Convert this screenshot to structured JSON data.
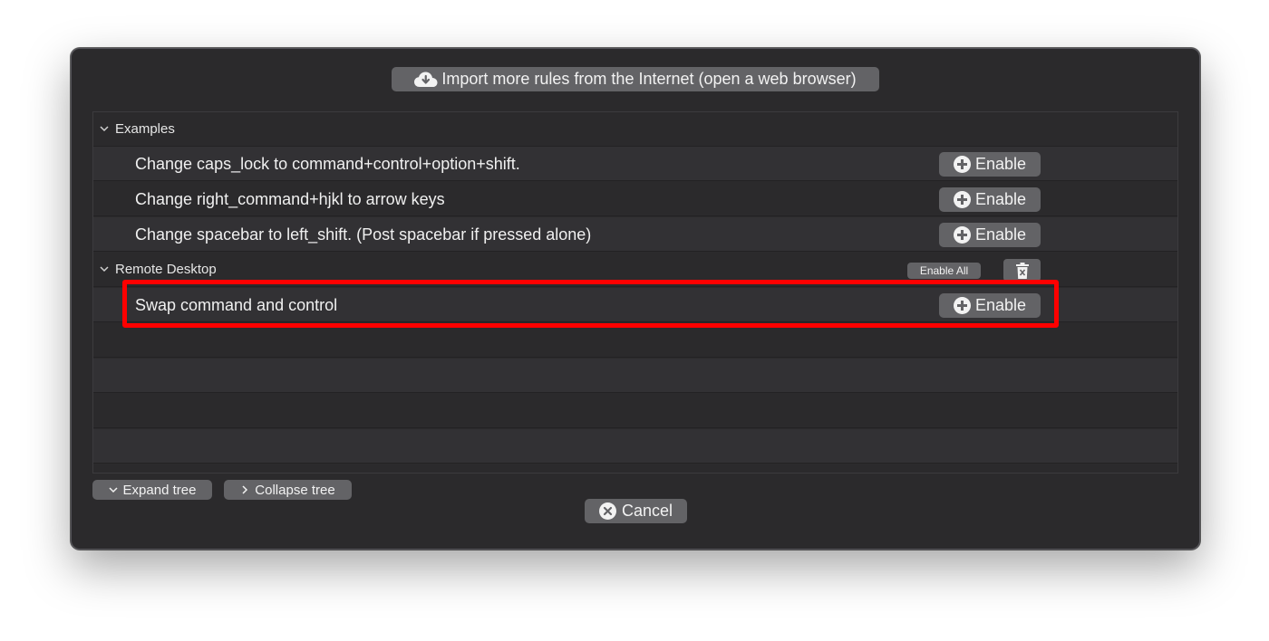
{
  "header": {
    "import_button_label": "Import more rules from the Internet (open a web browser)",
    "import_icon": "cloud-download-icon"
  },
  "tree": {
    "groups": [
      {
        "label": "Examples",
        "rules": [
          {
            "label": "Change caps_lock to command+control+option+shift.",
            "button": "Enable"
          },
          {
            "label": "Change right_command+hjkl to arrow keys",
            "button": "Enable"
          },
          {
            "label": "Change spacebar to left_shift. (Post spacebar if pressed alone)",
            "button": "Enable"
          }
        ]
      },
      {
        "label": "Remote Desktop",
        "enable_all_label": "Enable All",
        "delete_icon": "trash-icon",
        "rules": [
          {
            "label": "Swap command and control",
            "button": "Enable"
          }
        ]
      }
    ]
  },
  "footer": {
    "expand_label": "Expand tree",
    "collapse_label": "Collapse tree",
    "cancel_label": "Cancel"
  },
  "colors": {
    "window_bg": "#2b2a2c",
    "button_bg": "#636366",
    "highlight": "#ff0000"
  }
}
